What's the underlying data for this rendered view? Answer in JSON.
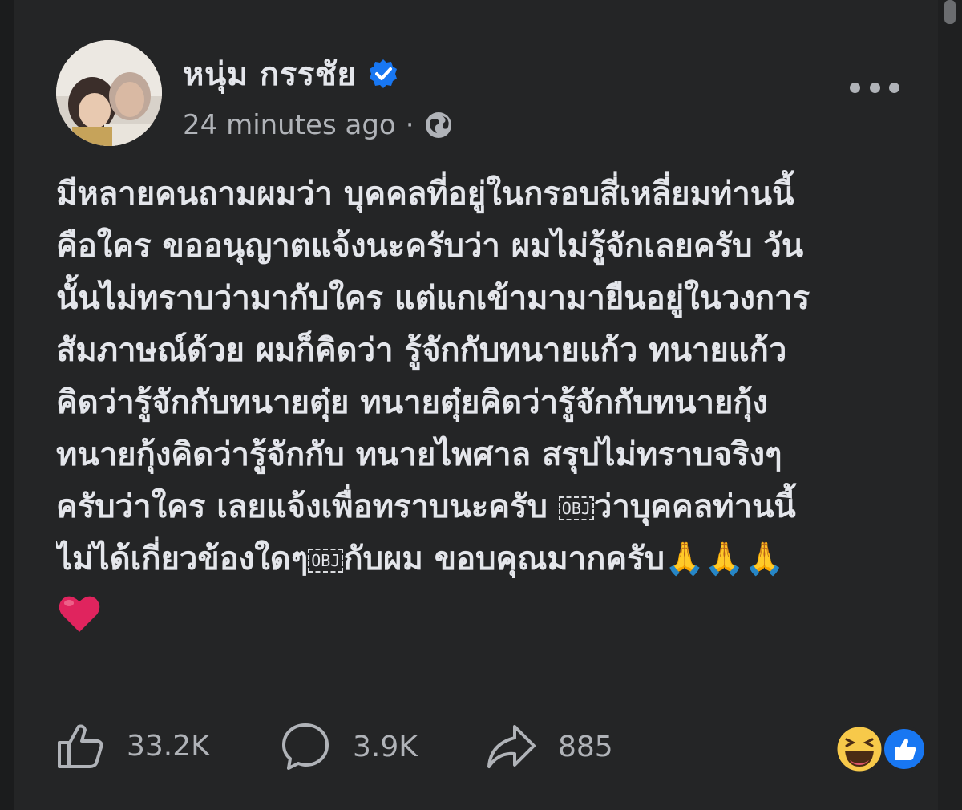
{
  "post": {
    "author_name": "หนุ่ม กรรชัย",
    "timestamp": "24 minutes ago",
    "separator": "·",
    "privacy_icon": "globe-icon",
    "verified_icon": "verified-badge-icon",
    "more_icon": "more-options-icon",
    "text_lines": [
      "มีหลายคนถามผมว่า บุคคลที่อยู่ในกรอบสี่เหลี่ยมท่านนี้",
      "คือใคร ขออนุญาตแจ้งนะครับว่า ผมไม่รู้จักเลยครับ วัน",
      "นั้นไม่ทราบว่ามากับใคร แต่แกเข้ามามายืนอยู่ในวงการ",
      "สัมภาษณ์ด้วย ผมก็คิดว่า รู้จักกับทนายแก้ว ทนายแก้ว",
      "คิดว่ารู้จักกับทนายตุ๋ย ทนายตุ๋ยคิดว่ารู้จักกับทนายกุ้ง",
      "ทนายกุ้งคิดว่ารู้จักกับ ทนายไพศาล สรุปไม่ทราบจริงๆ"
    ],
    "line7_before": "ครับว่าใคร เลยแจ้งเพื่อทราบนะครับ ",
    "obj_marker": "OBJ",
    "line7_after": "ว่าบุคคลท่านนี้",
    "line8_before": "ไม่ได้เกี่ยวข้องใดๆ",
    "line8_after": "กับผม ขอบคุณมากครับ",
    "prayer_emoji": "🙏🙏🙏",
    "heart_emoji": "heart-icon"
  },
  "actions": {
    "like_count": "33.2K",
    "comment_count": "3.9K",
    "share_count": "885",
    "like_icon": "like-icon",
    "comment_icon": "comment-icon",
    "share_icon": "share-icon"
  },
  "reactions": {
    "icons": [
      "haha-reaction-icon",
      "like-reaction-icon"
    ]
  },
  "colors": {
    "background": "#242526",
    "text_primary": "#e4e6eb",
    "text_secondary": "#b0b3b8",
    "verified_blue": "#1877f2",
    "heart_red": "#e0245e"
  }
}
